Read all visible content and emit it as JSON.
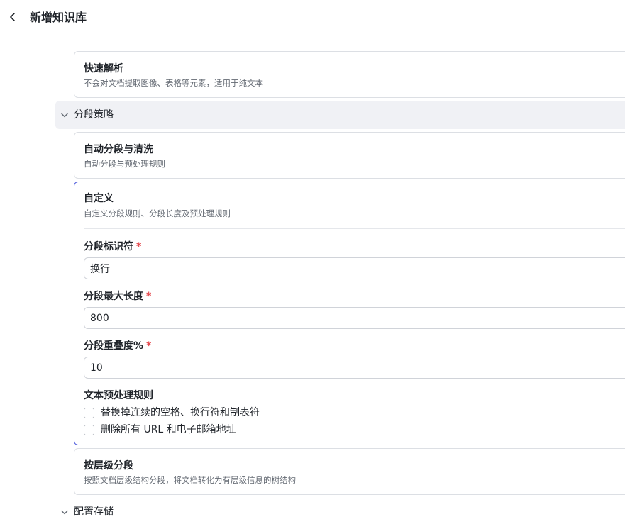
{
  "header": {
    "back_icon": "chevron-left-icon",
    "title": "新增知识库"
  },
  "parse_option": {
    "title": "快速解析",
    "desc": "不会对文档提取图像、表格等元素，适用于纯文本"
  },
  "segment_section": {
    "label": "分段策略",
    "icon": "chevron-down-icon",
    "options": [
      {
        "title": "自动分段与清洗",
        "desc": "自动分段与预处理规则"
      },
      {
        "title": "自定义",
        "desc": "自定义分段规则、分段长度及预处理规则"
      },
      {
        "title": "按层级分段",
        "desc": "按照文档层级结构分段，将文档转化为有层级信息的树结构"
      }
    ],
    "custom": {
      "identifier_label": "分段标识符",
      "identifier_value": "换行",
      "max_length_label": "分段最大长度",
      "max_length_value": "800",
      "overlap_label": "分段重叠度%",
      "overlap_value": "10",
      "required_mark": "*",
      "preprocess_label": "文本预处理规则",
      "rules": [
        {
          "label": "替换掉连续的空格、换行符和制表符",
          "checked": false
        },
        {
          "label": "删除所有 URL 和电子邮箱地址",
          "checked": false
        }
      ]
    }
  },
  "storage_section": {
    "label": "配置存储",
    "icon": "chevron-down-icon"
  },
  "colors": {
    "accent": "#4e5bdb",
    "required": "#e5484d",
    "section_bg": "#f0f1f5"
  }
}
